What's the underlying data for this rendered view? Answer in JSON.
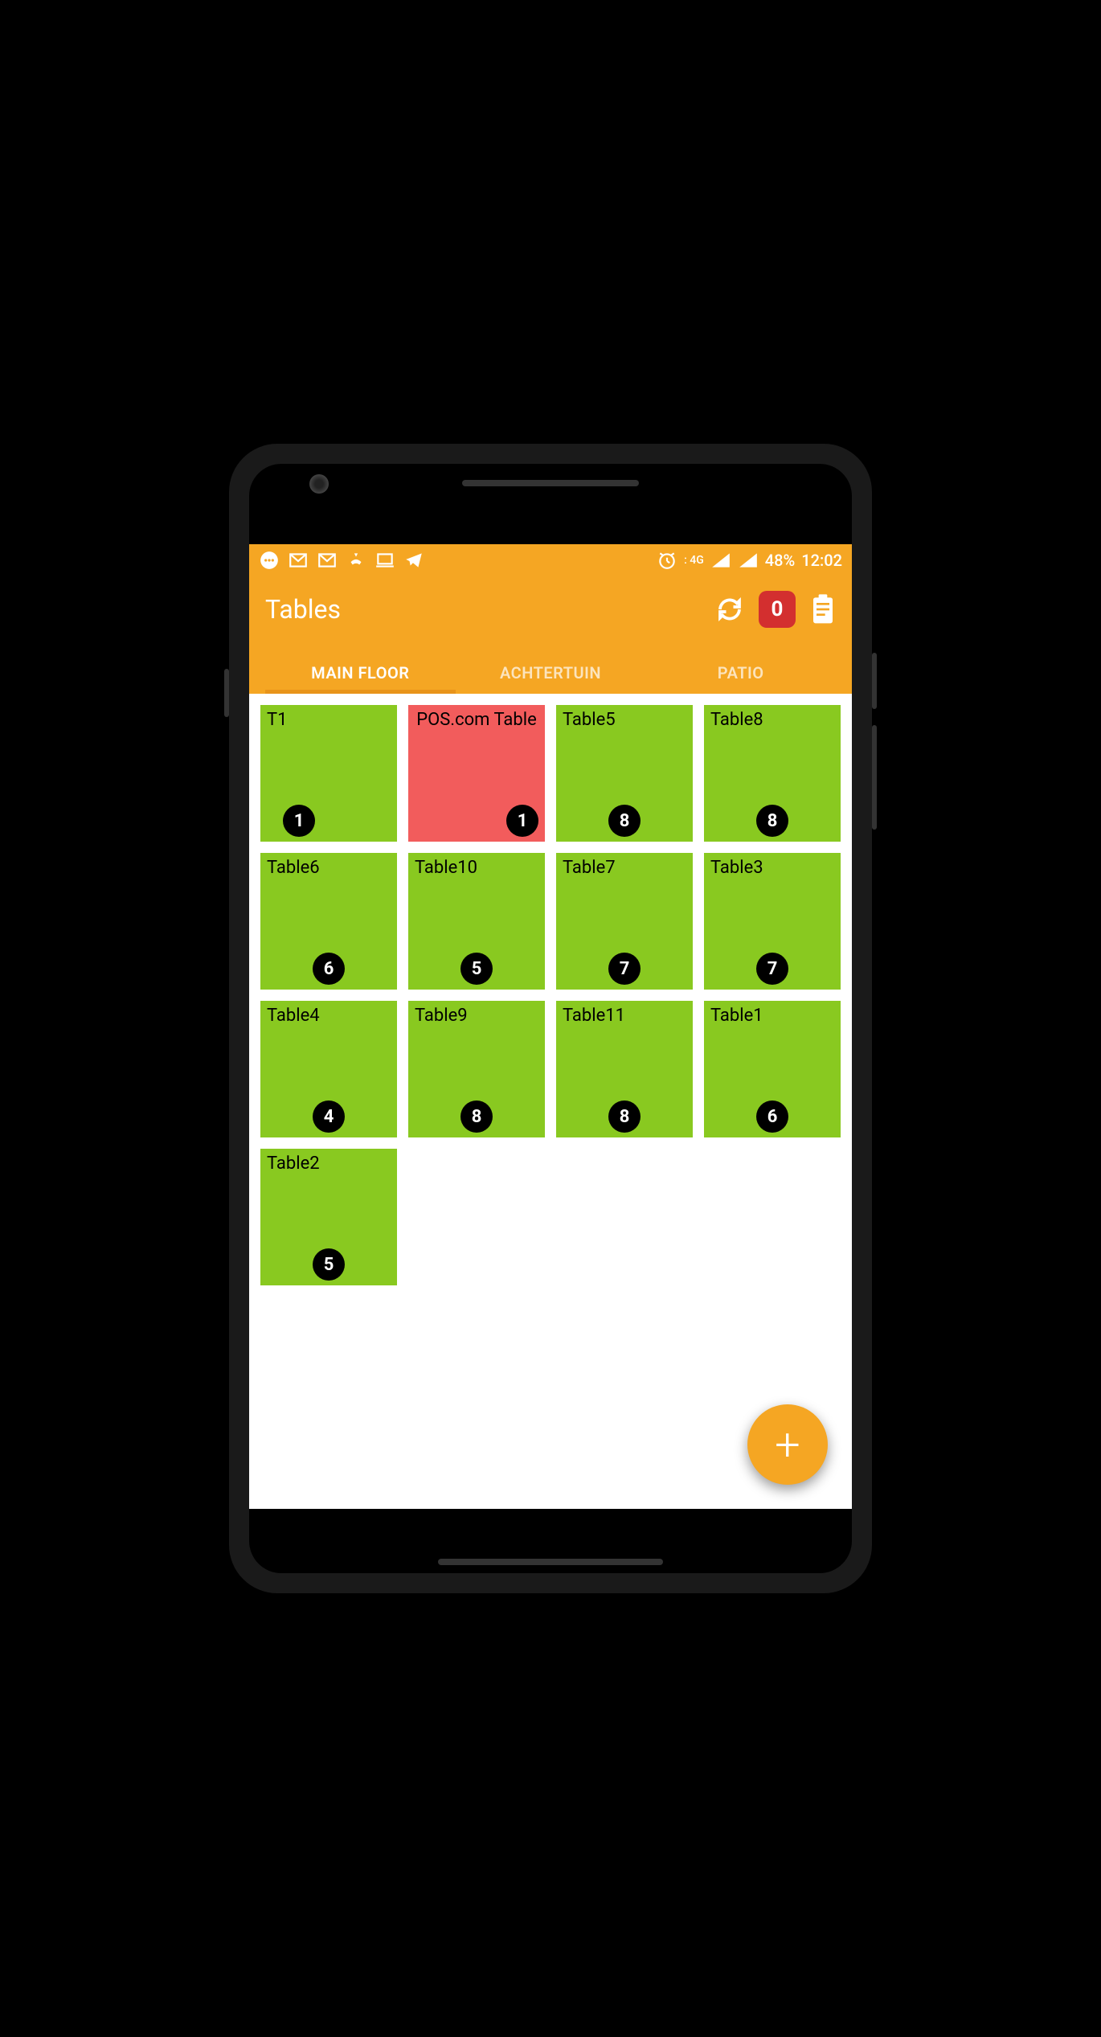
{
  "status_bar": {
    "battery": "48%",
    "time": "12:02",
    "network_label": "4G"
  },
  "header": {
    "title": "Tables",
    "badge_count": "0"
  },
  "tabs": [
    {
      "label": "MAIN FLOOR",
      "active": true
    },
    {
      "label": "ACHTERTUIN",
      "active": false
    },
    {
      "label": "PATIO",
      "active": false
    }
  ],
  "tables": [
    {
      "name": "T1",
      "count": "1",
      "status": "green"
    },
    {
      "name": "POS.com Table",
      "count": "1",
      "status": "red"
    },
    {
      "name": "Table5",
      "count": "8",
      "status": "green"
    },
    {
      "name": "Table8",
      "count": "8",
      "status": "green"
    },
    {
      "name": "Table6",
      "count": "6",
      "status": "green"
    },
    {
      "name": "Table10",
      "count": "5",
      "status": "green"
    },
    {
      "name": "Table7",
      "count": "7",
      "status": "green"
    },
    {
      "name": "Table3",
      "count": "7",
      "status": "green"
    },
    {
      "name": "Table4",
      "count": "4",
      "status": "green"
    },
    {
      "name": "Table9",
      "count": "8",
      "status": "green"
    },
    {
      "name": "Table11",
      "count": "8",
      "status": "green"
    },
    {
      "name": "Table1",
      "count": "6",
      "status": "green"
    },
    {
      "name": "Table2",
      "count": "5",
      "status": "green"
    }
  ]
}
